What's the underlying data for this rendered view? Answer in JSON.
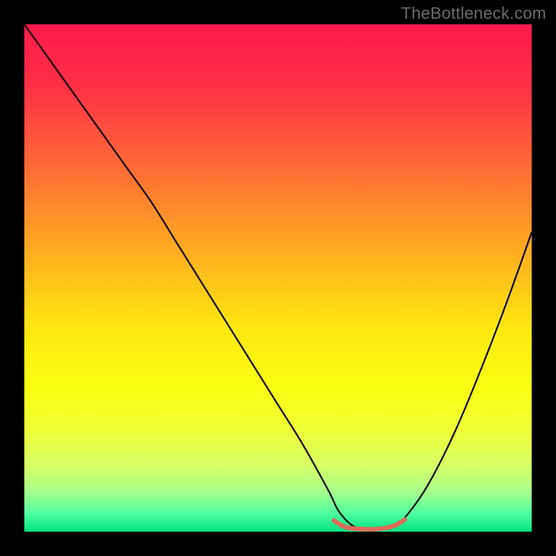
{
  "watermark": "TheBottleneck.com",
  "chart_data": {
    "type": "line",
    "title": "",
    "xlabel": "",
    "ylabel": "",
    "xlim": [
      0,
      100
    ],
    "ylim": [
      0,
      100
    ],
    "grid": false,
    "legend": false,
    "background_gradient": {
      "stops": [
        {
          "offset": 0.0,
          "color": "#ff1a4b"
        },
        {
          "offset": 0.12,
          "color": "#ff2f47"
        },
        {
          "offset": 0.28,
          "color": "#ff6a36"
        },
        {
          "offset": 0.45,
          "color": "#ffae1f"
        },
        {
          "offset": 0.6,
          "color": "#ffe80f"
        },
        {
          "offset": 0.72,
          "color": "#faff12"
        },
        {
          "offset": 0.8,
          "color": "#efff36"
        },
        {
          "offset": 0.87,
          "color": "#d6ff66"
        },
        {
          "offset": 0.92,
          "color": "#a8ff8a"
        },
        {
          "offset": 0.965,
          "color": "#4dffa0"
        },
        {
          "offset": 1.0,
          "color": "#00e27f"
        }
      ]
    },
    "series": [
      {
        "name": "bottleneck-curve",
        "color": "#000000",
        "width": 2.3,
        "x": [
          0,
          5,
          10,
          15,
          20,
          25,
          30,
          35,
          40,
          45,
          50,
          55,
          60,
          62,
          65,
          68,
          70,
          73,
          76,
          80,
          85,
          90,
          95,
          100
        ],
        "values": [
          100,
          93,
          86,
          79,
          72,
          65,
          57,
          49,
          41,
          33,
          25,
          17,
          8,
          4,
          1,
          0.5,
          0.5,
          1,
          4,
          10,
          20,
          32,
          45,
          59
        ]
      },
      {
        "name": "optimal-band",
        "color": "#e06a5a",
        "width": 6.5,
        "linecap": "round",
        "x": [
          61,
          63,
          65,
          67,
          69,
          71,
          73,
          75
        ],
        "values": [
          2.2,
          1.0,
          0.6,
          0.5,
          0.5,
          0.7,
          1.2,
          2.4
        ]
      }
    ]
  }
}
